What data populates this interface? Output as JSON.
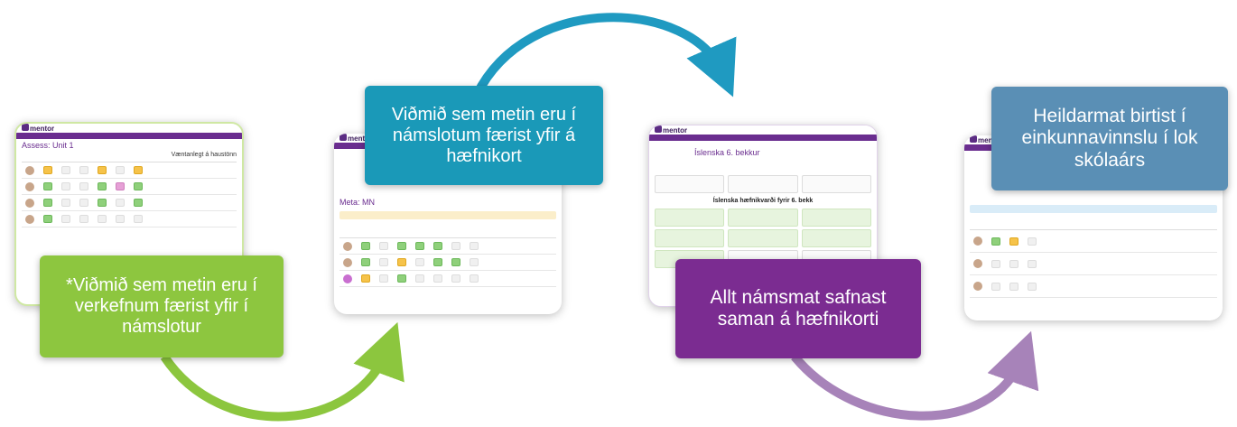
{
  "colors": {
    "green": "#8dc63f",
    "teal": "#1a99b8",
    "purple": "#7b2c91",
    "steel": "#5a8fb5",
    "arrow_teal": "#1f9ac1",
    "arrow_green": "#8cc63e",
    "arrow_lilac": "#a783b9",
    "arrow_steel": "#6b98bf"
  },
  "screens": [
    {
      "logo": "mentor",
      "heading": "Assess: Unit 1",
      "subtitle": "Væntanlegt á haustönn"
    },
    {
      "logo": "mentor",
      "heading": "Meta: MN"
    },
    {
      "logo": "mentor",
      "heading": "Íslenska 6. bekkur",
      "section_title": "Íslenska hæfnikvarði fyrir 6. bekk"
    },
    {
      "logo": "mentor"
    }
  ],
  "labels": {
    "step1": "*Viðmið sem metin eru í verkefnum færist yfir í námslotur",
    "step2": "Viðmið sem metin eru í námslotum færist yfir á hæfnikort",
    "step3": "Allt námsmat safnast saman á hæfnikorti",
    "step4": "Heildarmat birtist í einkunnavinnslu í lok skólaárs"
  }
}
